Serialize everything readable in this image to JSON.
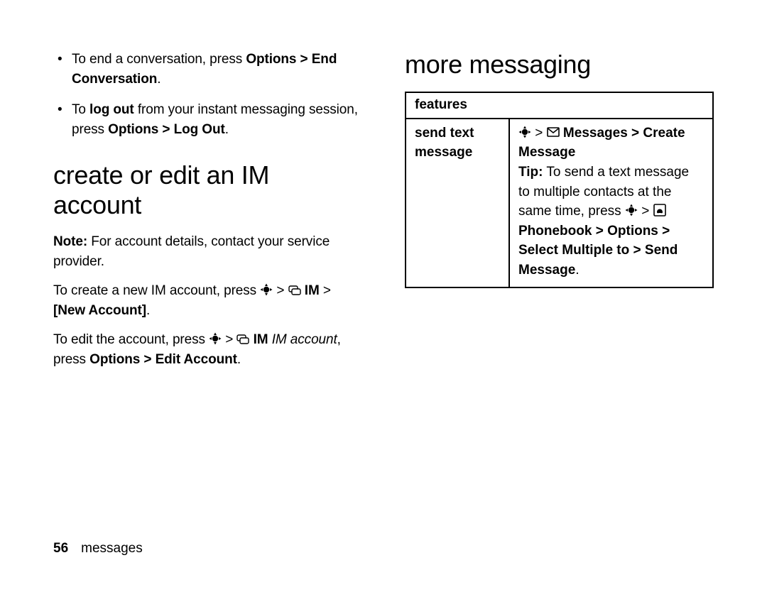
{
  "left": {
    "bullets": [
      {
        "pre": "To end a conversation, press ",
        "bold1": "Options > End Conversation",
        "post": "."
      },
      {
        "pre": "To ",
        "strong": "log out",
        "mid": " from your instant messaging session, press ",
        "bold1": "Options > Log Out",
        "post": "."
      }
    ],
    "heading": "create or edit an IM account",
    "note_label": "Note:",
    "note_text": " For account details, contact your service provider.",
    "create_pre": "To create a new IM account, press ",
    "create_gt": " > ",
    "create_im": " IM",
    "create_post": " > ",
    "create_new": "[New Account]",
    "create_end": ".",
    "edit_pre": "To edit the account, press ",
    "edit_gt": " > ",
    "edit_im": " IM",
    "edit_ital": " IM account",
    "edit_mid": ", press ",
    "edit_bold": "Options > Edit Account",
    "edit_end": "."
  },
  "right": {
    "heading": "more messaging",
    "th": "features",
    "row_label": "send text message",
    "path_gt": " > ",
    "path_msgs": " Messages > Create Message",
    "tip_label": "Tip:",
    "tip_text": " To send a text message to multiple contacts at the same time, press ",
    "tip_gt": " > ",
    "tip_pb": " Phonebook",
    "tip_path": " > Options > Select Multiple to > Send Message",
    "tip_end": "."
  },
  "footer": {
    "page": "56",
    "section": "messages"
  }
}
